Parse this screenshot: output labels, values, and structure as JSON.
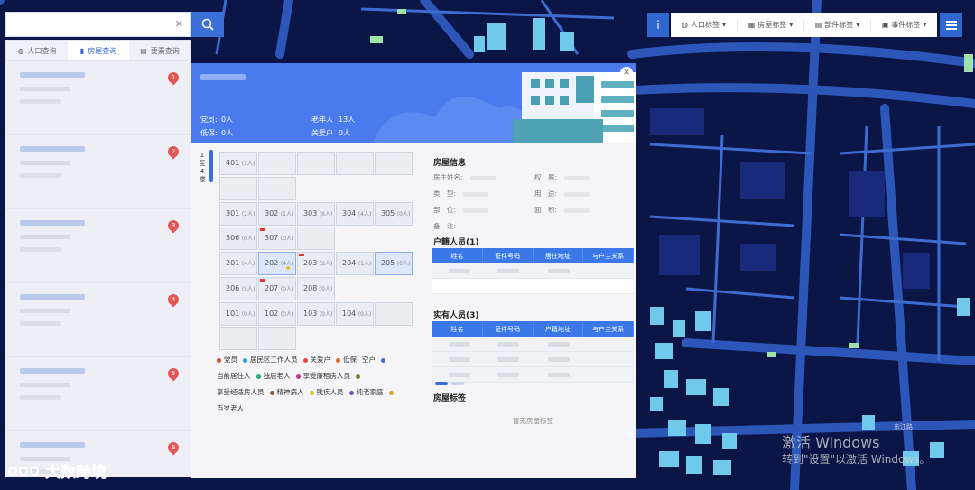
{
  "search": {
    "placeholder": ""
  },
  "tabs": [
    {
      "label": "人口查询",
      "icon": "globe-icon"
    },
    {
      "label": "房屋查询",
      "icon": "building-icon"
    },
    {
      "label": "要素查询",
      "icon": "layers-icon"
    }
  ],
  "list": {
    "pins": [
      "1",
      "2",
      "3",
      "4",
      "5",
      "6"
    ]
  },
  "toolbar": {
    "info_label": "i",
    "items": [
      {
        "label": "人口标签",
        "icon": "people-icon"
      },
      {
        "label": "房屋标签",
        "icon": "building-icon"
      },
      {
        "label": "部件标签",
        "icon": "component-icon"
      },
      {
        "label": "事件标签",
        "icon": "clipboard-icon"
      }
    ]
  },
  "panel": {
    "stats": {
      "party_label": "党员:",
      "party_value": "0人",
      "elderly_label": "老年人",
      "elderly_value": "13人",
      "lowinc_label": "低保:",
      "lowinc_value": "0人",
      "care_label": "关爱户",
      "care_value": "0人"
    },
    "floor_tab": "1至4楼",
    "rooms": [
      {
        "no": "401",
        "count": "(1人)"
      },
      {
        "no": "301",
        "count": "(2人)"
      },
      {
        "no": "302",
        "count": "(1人)"
      },
      {
        "no": "303",
        "count": "(6人)"
      },
      {
        "no": "304",
        "count": "(4人)"
      },
      {
        "no": "305",
        "count": "(0人)"
      },
      {
        "no": "306",
        "count": "(0人)"
      },
      {
        "no": "307",
        "count": "(0人)"
      },
      {
        "no": "201",
        "count": "(4人)"
      },
      {
        "no": "202",
        "count": "(4人)"
      },
      {
        "no": "203",
        "count": "(2人)"
      },
      {
        "no": "204",
        "count": "(1人)"
      },
      {
        "no": "205",
        "count": "(6人)"
      },
      {
        "no": "206",
        "count": "(5人)"
      },
      {
        "no": "207",
        "count": "(0人)"
      },
      {
        "no": "208",
        "count": "(0人)"
      },
      {
        "no": "101",
        "count": "(0人)"
      },
      {
        "no": "102",
        "count": "(0人)"
      },
      {
        "no": "103",
        "count": "(0人)"
      },
      {
        "no": "104",
        "count": "(0人)"
      }
    ],
    "legend": [
      {
        "label": "党员",
        "color": "#e04a3a"
      },
      {
        "label": "居民区工作人员",
        "color": "#2a9ed8"
      },
      {
        "label": "关爱户",
        "color": "#e04a3a"
      },
      {
        "label": "低保",
        "color": "#e06a2a"
      },
      {
        "label": "空户",
        "color": "#ffffff"
      },
      {
        "label": "",
        "color": "#3a6fd8"
      },
      {
        "label": "当前居住人",
        "color": "#ffffff"
      },
      {
        "label": "独居老人",
        "color": "#2aa87a"
      },
      {
        "label": "享受廉租房人员",
        "color": "#c03a9a"
      },
      {
        "label": "",
        "color": "#6a8a3a"
      },
      {
        "label": "享受经适房人员",
        "color": "#ffffff"
      },
      {
        "label": "精神病人",
        "color": "#8a5a3a"
      },
      {
        "label": "残疾人员",
        "color": "#e0c02a"
      },
      {
        "label": "纯老家庭",
        "color": "#7a4ac8"
      },
      {
        "label": "",
        "color": "#e0a02a"
      },
      {
        "label": "百岁老人",
        "color": "#ffffff"
      }
    ],
    "house_info": {
      "title": "房屋信息",
      "owner": "房主姓名:",
      "rights": "权　属:",
      "type": "类　型:",
      "usage": "用　途:",
      "part": "部　位:",
      "area": "面　积:",
      "remark": "备　注:"
    },
    "registered": {
      "title": "户籍人员(1)",
      "headers": [
        "姓名",
        "证件号码",
        "居住地址",
        "与户主关系"
      ]
    },
    "actual": {
      "title": "实有人员(3)",
      "headers": [
        "姓名",
        "证件号码",
        "户籍地址",
        "与户主关系"
      ]
    },
    "tags": {
      "title": "房屋标签",
      "empty": "暂无房屋标签"
    }
  },
  "watermark": {
    "line1": "激活 Windows",
    "line2": "转到\"设置\"以激活 Windows。"
  },
  "logo": {
    "text": "大数跨境"
  },
  "map_labels": {
    "road": "东江路"
  }
}
